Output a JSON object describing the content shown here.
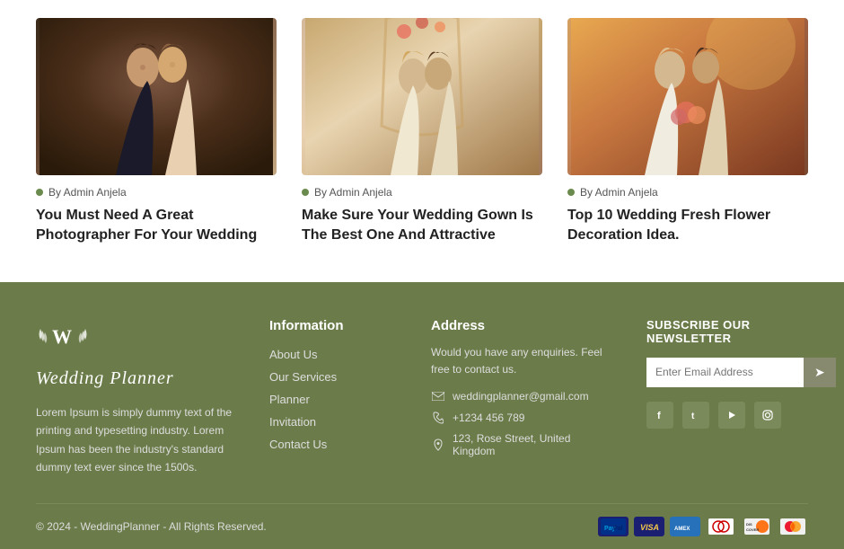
{
  "blog": {
    "cards": [
      {
        "author": "By Admin Anjela",
        "title": "You Must Need A Great Photographer For Your Wedding",
        "image_theme": "couple1"
      },
      {
        "author": "By Admin Anjela",
        "title": "Make Sure Your Wedding Gown Is The Best One And Attractive",
        "image_theme": "couple2"
      },
      {
        "author": "By Admin Anjela",
        "title": "Top 10 Wedding Fresh Flower Decoration Idea.",
        "image_theme": "couple3"
      }
    ]
  },
  "footer": {
    "brand": {
      "logo_icon": "❧",
      "logo_text": "Wedding Planner",
      "description": "Lorem Ipsum is simply dummy text of  the printing and typesetting industry. Lorem Ipsum has been the industry's standard dummy text ever since the 1500s."
    },
    "information": {
      "title": "Information",
      "links": [
        "About Us",
        "Our Services",
        "Planner",
        "Invitation",
        "Contact Us"
      ]
    },
    "address": {
      "title": "Address",
      "intro": "Would you have any enquiries. Feel free to contact us.",
      "email": "weddingplanner@gmail.com",
      "phone": "+1234 456 789",
      "location": "123, Rose Street, United Kingdom"
    },
    "newsletter": {
      "title": "SUBSCRIBE OUR NEWSLETTER",
      "placeholder": "Enter Email Address",
      "button_icon": "➤"
    },
    "social": [
      "f",
      "t",
      "▶",
      "📷"
    ],
    "bottom": {
      "copyright": "© 2024 - WeddingPlanner - All Rights Reserved.",
      "payments": [
        "PayPal",
        "VISA",
        "AMEX",
        "DC",
        "DS",
        "MC"
      ]
    }
  }
}
